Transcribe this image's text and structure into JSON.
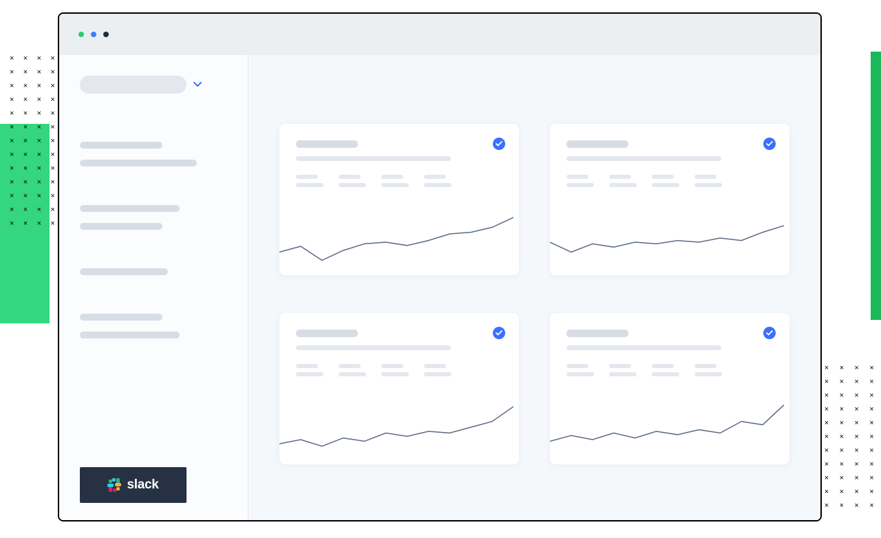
{
  "sidebar": {
    "integration": {
      "label": "slack"
    }
  },
  "cards": [
    {
      "status": "checked"
    },
    {
      "status": "checked"
    },
    {
      "status": "checked"
    },
    {
      "status": "checked"
    }
  ],
  "chart_data": [
    {
      "type": "line",
      "x": [
        0,
        1,
        2,
        3,
        4,
        5,
        6,
        7,
        8,
        9,
        10,
        11
      ],
      "values": [
        72,
        65,
        82,
        70,
        62,
        60,
        64,
        58,
        50,
        48,
        42,
        30
      ],
      "ylim": [
        0,
        100
      ]
    },
    {
      "type": "line",
      "x": [
        0,
        1,
        2,
        3,
        4,
        5,
        6,
        7,
        8,
        9,
        10,
        11
      ],
      "values": [
        60,
        72,
        62,
        66,
        60,
        62,
        58,
        60,
        55,
        58,
        48,
        40
      ],
      "ylim": [
        0,
        100
      ]
    },
    {
      "type": "line",
      "x": [
        0,
        1,
        2,
        3,
        4,
        5,
        6,
        7,
        8,
        9,
        10,
        11
      ],
      "values": [
        75,
        70,
        78,
        68,
        72,
        62,
        66,
        60,
        62,
        55,
        48,
        30
      ],
      "ylim": [
        0,
        100
      ]
    },
    {
      "type": "line",
      "x": [
        0,
        1,
        2,
        3,
        4,
        5,
        6,
        7,
        8,
        9,
        10,
        11
      ],
      "values": [
        72,
        65,
        70,
        62,
        68,
        60,
        64,
        58,
        62,
        48,
        52,
        28
      ],
      "ylim": [
        0,
        100
      ]
    }
  ]
}
